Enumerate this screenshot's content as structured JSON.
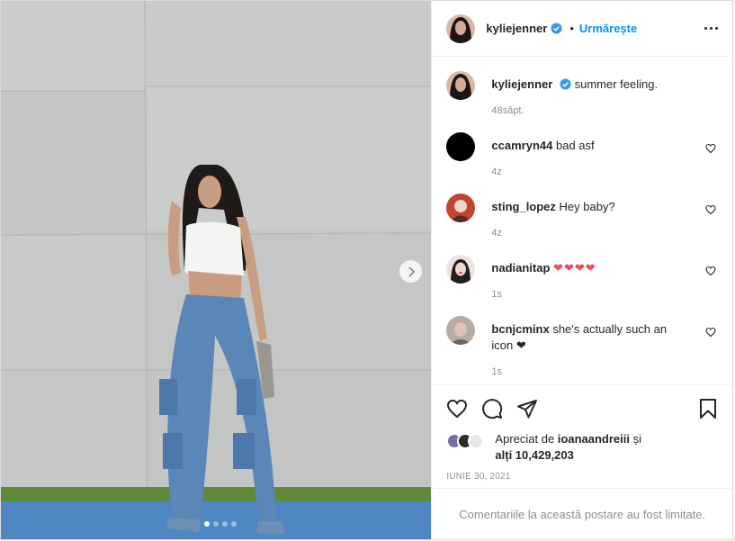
{
  "post": {
    "author": "kyliejenner",
    "follow_label": "Urmărește",
    "bullet": "•"
  },
  "caption": {
    "username": "kyliejenner",
    "text": "summer feeling.",
    "time": "48săpt."
  },
  "comments": [
    {
      "username": "ccamryn44",
      "text": "bad asf",
      "time": "4z"
    },
    {
      "username": "sting_lopez",
      "text": "Hey baby?",
      "time": "4z"
    },
    {
      "username": "nadianitap",
      "text": "❤❤❤❤",
      "time": "1s"
    },
    {
      "username": "bcnjcminx",
      "text": "she's actually such an icon ❤",
      "time": "1s"
    }
  ],
  "likes": {
    "prefix": "Apreciat de",
    "user": "ioanaandreiii",
    "conj": "și",
    "others": "alți 10,429,203"
  },
  "date": "Iunie 30, 2021",
  "comments_limited": "Comentariile la această postare au fost limitate.",
  "colors": {
    "link": "#0095f6",
    "verified": "#3897f0",
    "heart": "#ed4956"
  },
  "icons": [
    "verified-icon",
    "more-icon",
    "heart-icon",
    "comment-icon",
    "share-icon",
    "bookmark-icon",
    "chevron-right-icon"
  ],
  "carousel": {
    "count": 4,
    "active": 1
  }
}
